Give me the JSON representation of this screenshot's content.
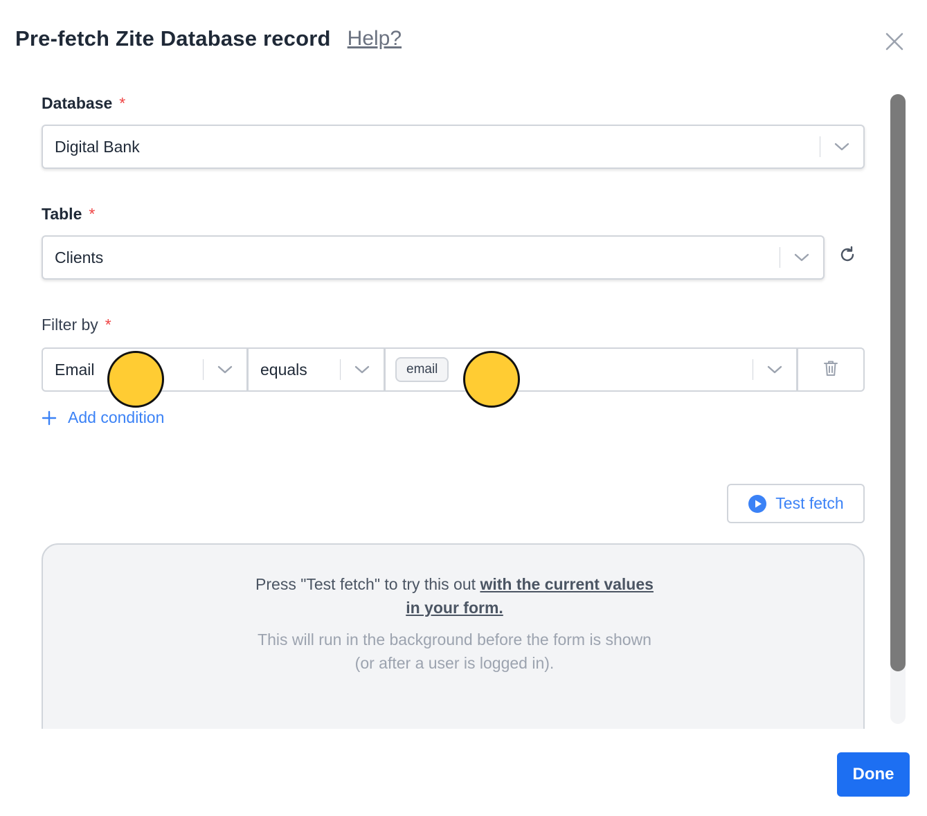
{
  "dialog": {
    "title": "Pre-fetch Zite Database record",
    "help_link": "Help?",
    "close_icon": "close-icon"
  },
  "database": {
    "label": "Database",
    "required_mark": "*",
    "value": "Digital Bank"
  },
  "table": {
    "label": "Table",
    "required_mark": "*",
    "value": "Clients",
    "refresh_icon": "refresh-icon"
  },
  "filter": {
    "label": "Filter by",
    "required_mark": "*",
    "field_value": "Email",
    "operator_value": "equals",
    "value_tag": "email",
    "delete_icon": "trash-icon"
  },
  "add_condition": {
    "label": "Add condition",
    "icon": "plus-icon"
  },
  "test_fetch": {
    "label": "Test fetch",
    "icon": "play-circle-icon"
  },
  "info": {
    "line1_prefix": "Press \"Test fetch\" to try this out ",
    "line1_link": "with the current values in your form.",
    "line2": "This will run in the background before the form is shown (or after a user is logged in)."
  },
  "footer": {
    "done_label": "Done"
  },
  "colors": {
    "accent": "#3b82f6",
    "primary_button": "#1d6ff2",
    "required": "#ef4444",
    "cursor_marker": "#ffcc33"
  }
}
